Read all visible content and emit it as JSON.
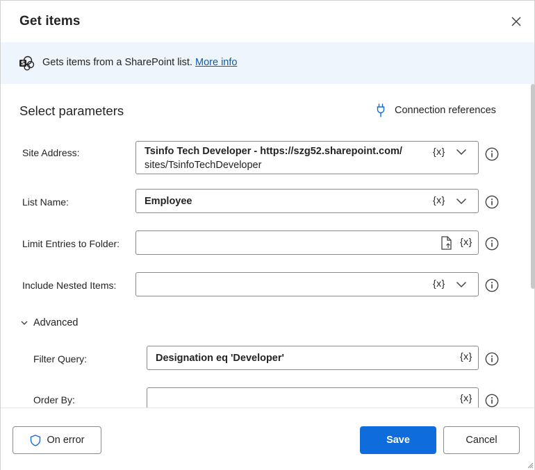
{
  "dialog": {
    "title": "Get items",
    "close_icon": "close-icon"
  },
  "banner": {
    "text": "Gets items from a SharePoint list.",
    "link": "More info",
    "icon": "sharepoint-icon"
  },
  "parameters": {
    "section_title": "Select parameters",
    "connection_references": "Connection references",
    "var_token": "{x}",
    "site_address": {
      "label": "Site Address:",
      "value_line1": "Tsinfo Tech Developer - https://szg52.sharepoint.com/",
      "value_line2": "sites/TsinfoTechDeveloper"
    },
    "list_name": {
      "label": "List Name:",
      "value": "Employee"
    },
    "limit_folder": {
      "label": "Limit Entries to Folder:",
      "value": ""
    },
    "nested_items": {
      "label": "Include Nested Items:",
      "value": ""
    },
    "advanced": {
      "label": "Advanced",
      "filter_query": {
        "label": "Filter Query:",
        "value": "Designation eq 'Developer'"
      },
      "order_by": {
        "label": "Order By:",
        "value": ""
      }
    }
  },
  "footer": {
    "on_error": "On error",
    "save": "Save",
    "cancel": "Cancel"
  },
  "colors": {
    "primary": "#0f6cdd",
    "banner_bg": "#eff5fc",
    "link": "#0f5aa8"
  }
}
